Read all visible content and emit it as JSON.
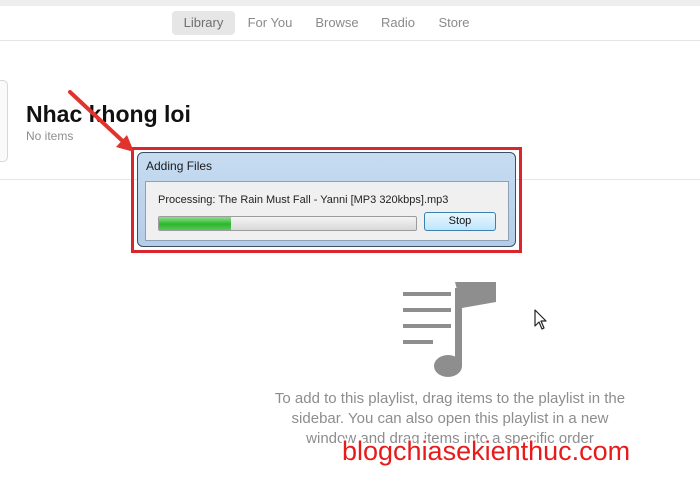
{
  "nav": {
    "tabs": [
      {
        "label": "Library",
        "active": true
      },
      {
        "label": "For You",
        "active": false
      },
      {
        "label": "Browse",
        "active": false
      },
      {
        "label": "Radio",
        "active": false
      },
      {
        "label": "Store",
        "active": false
      }
    ]
  },
  "playlist": {
    "title": "Nhac khong loi",
    "subtitle": "No items"
  },
  "dialog": {
    "title": "Adding Files",
    "processing_text": "Processing: The Rain Must Fall - Yanni [MP3 320kbps].mp3",
    "progress_fraction": 0.28,
    "stop_label": "Stop"
  },
  "empty_state": {
    "icon": "music-note-list-icon",
    "text": "To add to this playlist, drag items to the playlist in the sidebar. You can also open this playlist in a new window and drag items into a specific order"
  },
  "watermark": "blogchiasekienthuc.com",
  "colors": {
    "highlight": "#d9262c",
    "progress": "#2fb52f",
    "watermark": "#e81b1b"
  }
}
